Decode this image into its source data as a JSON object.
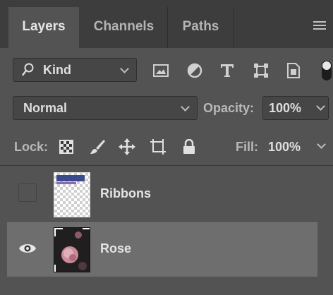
{
  "tabs": [
    {
      "label": "Layers",
      "active": true
    },
    {
      "label": "Channels",
      "active": false
    },
    {
      "label": "Paths",
      "active": false
    }
  ],
  "filter": {
    "kind_label": "Kind",
    "icons": [
      "image-filter-icon",
      "adjustment-filter-icon",
      "type-filter-icon",
      "shape-filter-icon",
      "smart-object-filter-icon",
      "filter-toggle-icon"
    ]
  },
  "blend": {
    "mode": "Normal",
    "opacity_label": "Opacity:",
    "opacity_value": "100%"
  },
  "lock": {
    "label": "Lock:",
    "icons": [
      "lock-transparent-pixels-icon",
      "lock-image-pixels-icon",
      "lock-position-icon",
      "lock-artboard-icon",
      "lock-all-icon"
    ],
    "fill_label": "Fill:",
    "fill_value": "100%"
  },
  "layers": [
    {
      "name": "Ribbons",
      "visible": false,
      "selected": false
    },
    {
      "name": "Rose",
      "visible": true,
      "selected": true
    }
  ],
  "colors": {
    "panel_bg": "#535353",
    "tabbar_bg": "#3d3d3d",
    "selected_row": "#6e6e6e",
    "text": "#e4e4e4"
  }
}
